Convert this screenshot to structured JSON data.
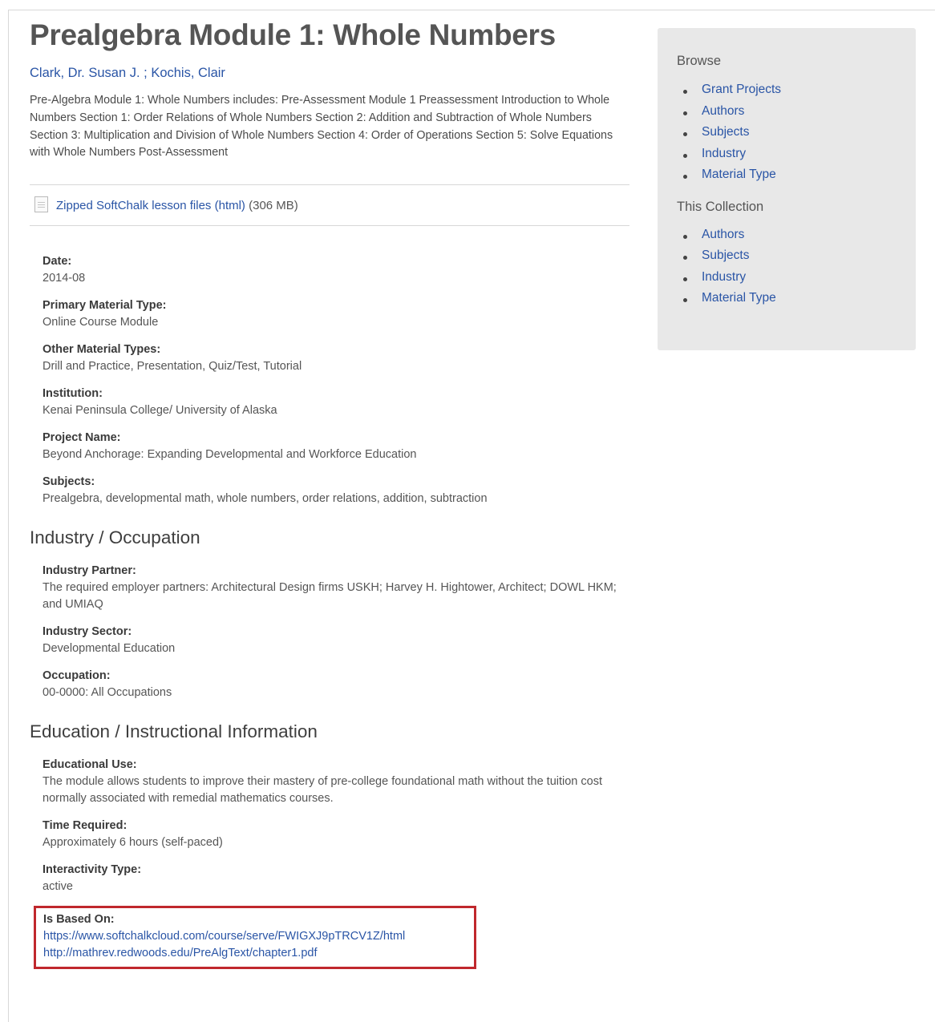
{
  "title": "Prealgebra Module 1: Whole Numbers",
  "authors": [
    "Clark, Dr. Susan J.",
    "Kochis, Clair"
  ],
  "author_separator": " ; ",
  "description": "Pre-Algebra Module 1: Whole Numbers includes: Pre-Assessment Module 1 Preassessment Introduction to Whole Numbers Section 1: Order Relations of Whole Numbers Section 2: Addition and Subtraction of Whole Numbers Section 3: Multiplication and Division of Whole Numbers Section 4: Order of Operations Section 5: Solve Equations with Whole Numbers Post-Assessment",
  "file": {
    "icon": "document-icon",
    "link_text": "Zipped SoftChalk lesson files (html)",
    "size": "(306 MB)"
  },
  "details": [
    {
      "label": "Date:",
      "value": "2014-08"
    },
    {
      "label": "Primary Material Type:",
      "value": "Online Course Module"
    },
    {
      "label": "Other Material Types:",
      "value": "Drill and Practice, Presentation, Quiz/Test, Tutorial"
    },
    {
      "label": "Institution:",
      "value": "Kenai Peninsula College/ University of Alaska"
    },
    {
      "label": "Project Name:",
      "value": "Beyond Anchorage: Expanding Developmental and Workforce Education"
    },
    {
      "label": "Subjects:",
      "value": "Prealgebra, developmental math, whole numbers, order relations, addition, subtraction"
    }
  ],
  "industry": {
    "heading": "Industry / Occupation",
    "fields": [
      {
        "label": "Industry Partner:",
        "value": "The required employer partners: Architectural Design firms USKH; Harvey H. Hightower, Architect; DOWL HKM; and UMIAQ"
      },
      {
        "label": "Industry Sector:",
        "value": "Developmental Education"
      },
      {
        "label": "Occupation:",
        "value": "00-0000: All Occupations"
      }
    ]
  },
  "education": {
    "heading": "Education / Instructional Information",
    "fields": [
      {
        "label": "Educational Use:",
        "value": "The module allows students to improve their mastery of pre-college foundational math without the tuition cost normally associated with remedial mathematics courses."
      },
      {
        "label": "Time Required:",
        "value": "Approximately 6 hours (self-paced)"
      },
      {
        "label": "Interactivity Type:",
        "value": "active"
      }
    ],
    "based_on": {
      "label": "Is Based On:",
      "links": [
        "https://www.softchalkcloud.com/course/serve/FWIGXJ9pTRCV1Z/html",
        "http://mathrev.redwoods.edu/PreAlgText/chapter1.pdf"
      ]
    }
  },
  "sidebar": {
    "browse_heading": "Browse",
    "browse_items": [
      "Grant Projects",
      "Authors",
      "Subjects",
      "Industry",
      "Material Type"
    ],
    "collection_heading": "This Collection",
    "collection_items": [
      "Authors",
      "Subjects",
      "Industry",
      "Material Type"
    ]
  },
  "colors": {
    "link": "#2a55a6",
    "highlight_border": "#c0282d",
    "sidebar_bg": "#e8e8e8"
  }
}
